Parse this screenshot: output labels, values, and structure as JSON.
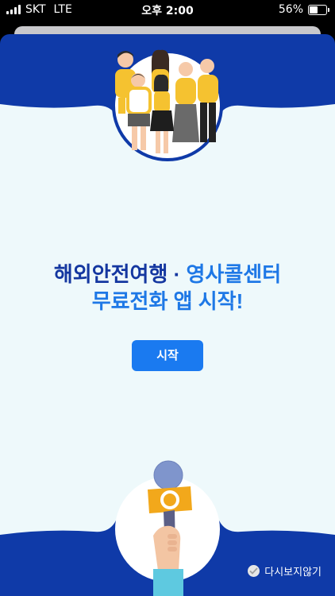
{
  "status_bar": {
    "carrier": "SKT",
    "network": "LTE",
    "time": "오후 2:00",
    "battery_percent": "56%",
    "battery_level": 0.56
  },
  "headline": {
    "line1_part1": "해외안전여행 · ",
    "line1_part2": "영사콜센터",
    "line2": "무료전화 앱 시작!"
  },
  "start_button_label": "시작",
  "dismiss_label": "다시보지않기",
  "colors": {
    "frame_blue": "#0f3aa8",
    "panel_bg": "#eef9fb",
    "accent_blue": "#1a7af0",
    "family_yellow": "#f5c230"
  },
  "icons": [
    "family-illustration",
    "microphone-illustration",
    "check-icon",
    "battery-icon",
    "signal-icon"
  ]
}
